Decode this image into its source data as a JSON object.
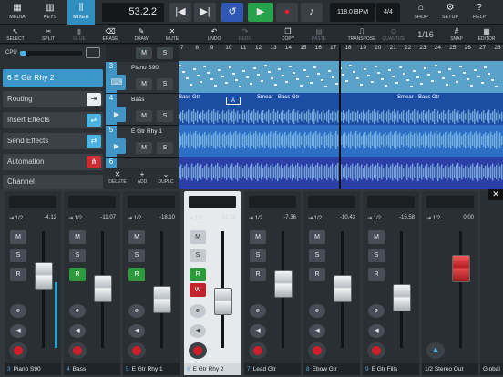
{
  "toolbar": {
    "media": "MEDIA",
    "keys": "KEYS",
    "mixer": "MIXER",
    "counter": "53.2.2",
    "tempo": "118.0 BPM",
    "signature": "4/4",
    "shop": "SHOP",
    "setup": "SETUP",
    "help": "HELP"
  },
  "tools": {
    "select": "SELECT",
    "split": "SPLIT",
    "glue": "GLUE",
    "erase": "ERASE",
    "draw": "DRAW",
    "mute": "MUTE",
    "undo": "UNDO",
    "redo": "REDO",
    "copy": "COPY",
    "paste": "PASTE",
    "transpose": "TRANSPOSE",
    "quantize": "QUANTIZE",
    "grid": "1/16",
    "snap": "SNAP",
    "editor": "EDITOR"
  },
  "inspector": {
    "cpu": "CPU",
    "track": "6 E Gtr Rhy 2",
    "routing": "Routing",
    "insert": "Insert Effects",
    "send": "Send Effects",
    "automation": "Automation",
    "channel": "Channel"
  },
  "ruler": [
    "7",
    "8",
    "9",
    "10",
    "11",
    "12",
    "13",
    "14",
    "15",
    "16",
    "17",
    "18",
    "19",
    "20",
    "21",
    "22",
    "23",
    "24",
    "25",
    "26",
    "27",
    "28"
  ],
  "tracks": [
    {
      "num": "3",
      "name": "Piano S90"
    },
    {
      "num": "4",
      "name": "Bass"
    },
    {
      "num": "5",
      "name": "E Gtr Rhy 1"
    },
    {
      "num": "6",
      "name": ""
    }
  ],
  "track_actions": {
    "delete": "DELETE",
    "add": "ADD",
    "duplicate": "DUPLC"
  },
  "clips": {
    "bass1": "Bass Gtr",
    "bass2": "Smear - Bass Gtr",
    "bass3": "Smear - Bass Gtr",
    "marker": "A"
  },
  "channels": [
    {
      "num": "3",
      "name": "Piano S90",
      "route": "1/2",
      "value": "-4.12",
      "fader_pct": 0.72,
      "meter_pct": 0.6
    },
    {
      "num": "4",
      "name": "Bass",
      "route": "1/2",
      "value": "-11.07",
      "fader_pct": 0.6,
      "meter_pct": 0.0
    },
    {
      "num": "5",
      "name": "E Gtr Rhy 1",
      "route": "1/2",
      "value": "-18.10",
      "fader_pct": 0.5,
      "meter_pct": 0.0
    },
    {
      "num": "6",
      "name": "E Gtr Rhy 2",
      "route": "1/2",
      "value": "-15.31",
      "fader_pct": 0.48,
      "meter_pct": 0.0
    },
    {
      "num": "7",
      "name": "Lead Gtr",
      "route": "1/2",
      "value": "-7.36",
      "fader_pct": 0.64,
      "meter_pct": 0.0
    },
    {
      "num": "8",
      "name": "Ebow Gtr",
      "route": "1/2",
      "value": "-10.43",
      "fader_pct": 0.6,
      "meter_pct": 0.0
    },
    {
      "num": "9",
      "name": "E Gtr Fills",
      "route": "1/2",
      "value": "-15.58",
      "fader_pct": 0.52,
      "meter_pct": 0.0
    }
  ],
  "master": {
    "name": "1/2 Stereo Out",
    "route": "1/2",
    "value": "0.00",
    "global": "Global"
  },
  "labels": {
    "m": "M",
    "s": "S",
    "r": "R",
    "e": "e"
  },
  "colors": {
    "accent": "#2f8fc0",
    "record": "#cf1e2a",
    "arm": "#2d9a3c"
  }
}
